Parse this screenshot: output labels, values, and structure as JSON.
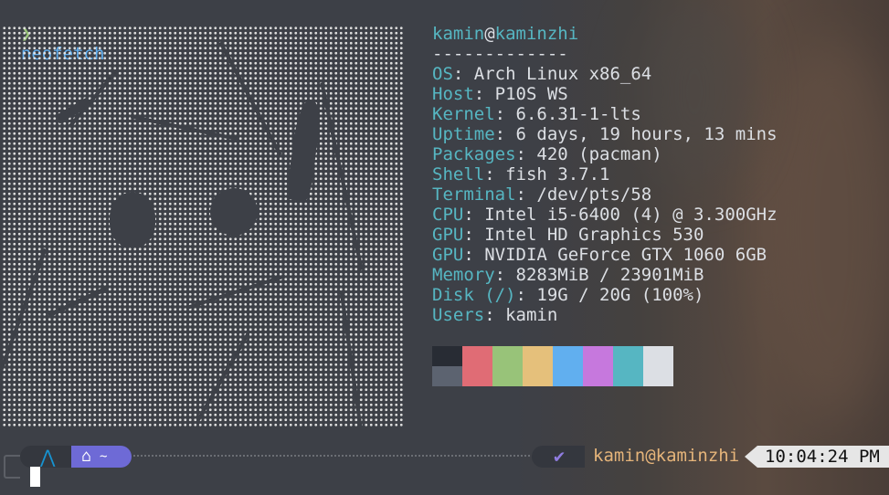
{
  "command": {
    "prompt_symbol": "❯",
    "text": "neofetch"
  },
  "info": {
    "user": "kamin",
    "at": "@",
    "host": "kaminzhi",
    "separator": "-------------",
    "rows": [
      {
        "key": "OS",
        "value": "Arch Linux x86_64"
      },
      {
        "key": "Host",
        "value": "P10S WS"
      },
      {
        "key": "Kernel",
        "value": "6.6.31-1-lts"
      },
      {
        "key": "Uptime",
        "value": "6 days, 19 hours, 13 mins"
      },
      {
        "key": "Packages",
        "value": "420 (pacman)"
      },
      {
        "key": "Shell",
        "value": "fish 3.7.1"
      },
      {
        "key": "Terminal",
        "value": "/dev/pts/58"
      },
      {
        "key": "CPU",
        "value": "Intel i5-6400 (4) @ 3.300GHz"
      },
      {
        "key": "GPU",
        "value": "Intel HD Graphics 530"
      },
      {
        "key": "GPU",
        "value": "NVIDIA GeForce GTX 1060 6GB"
      },
      {
        "key": "Memory",
        "value": "8283MiB / 23901MiB"
      },
      {
        "key": "Disk (/)",
        "value": "19G / 20G (100%)"
      },
      {
        "key": "Users",
        "value": "kamin"
      }
    ]
  },
  "palette": {
    "top": [
      "#282c34",
      "#e06c75",
      "#98c379",
      "#e5c07b",
      "#61afef",
      "#c678dd",
      "#56b6c2",
      "#dcdfe4"
    ],
    "bottom": [
      "#5c6370",
      "#e06c75",
      "#98c379",
      "#e5c07b",
      "#61afef",
      "#c678dd",
      "#56b6c2",
      "#dcdfe4"
    ]
  },
  "prompt": {
    "home_label": "~",
    "user_host": "kamin@kaminzhi",
    "time": "10:04:24 PM"
  },
  "icons": {
    "arch": "arch-logo-icon",
    "home": "home-icon",
    "check": "check-icon",
    "terminal": "terminal-icon"
  }
}
